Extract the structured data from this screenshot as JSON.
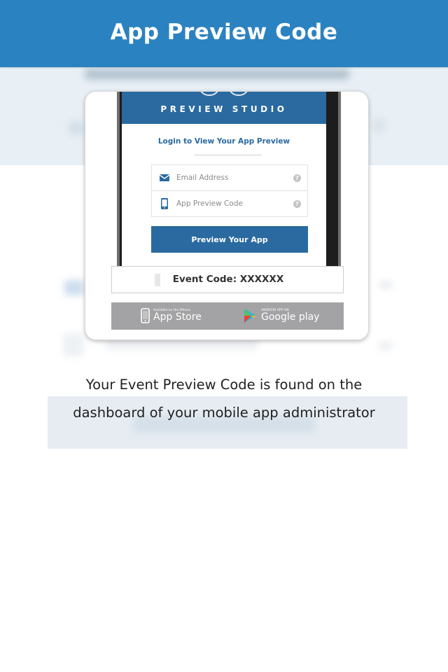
{
  "header": {
    "title": "App Preview Code"
  },
  "phone": {
    "brand_bar": "PREVIEW STUDIO",
    "login_title": "Login to View Your App Preview",
    "email_field": {
      "placeholder": "Email Address",
      "icon": "envelope-icon",
      "help_icon": "question-icon"
    },
    "code_field": {
      "placeholder": "App Preview Code",
      "icon": "mobile-phone-icon",
      "help_icon": "question-icon"
    },
    "submit_button": "Preview Your App",
    "help_glyph": "?"
  },
  "event_code": {
    "label": "Event Code: XXXXXX"
  },
  "stores": {
    "apple": {
      "small": "Available on the iPhone",
      "big": "App Store",
      "icon": "apple-phone-icon"
    },
    "google": {
      "small": "ANDROID APP ON",
      "big": "Google play",
      "icon": "google-play-icon"
    }
  },
  "caption": {
    "line1": "Your Event Preview Code is found on the",
    "line2": "dashboard of your mobile app administrator"
  },
  "colors": {
    "header": "#2b82c0",
    "brand_blue": "#2a6aa0",
    "store_bar": "#a3a3a5"
  }
}
